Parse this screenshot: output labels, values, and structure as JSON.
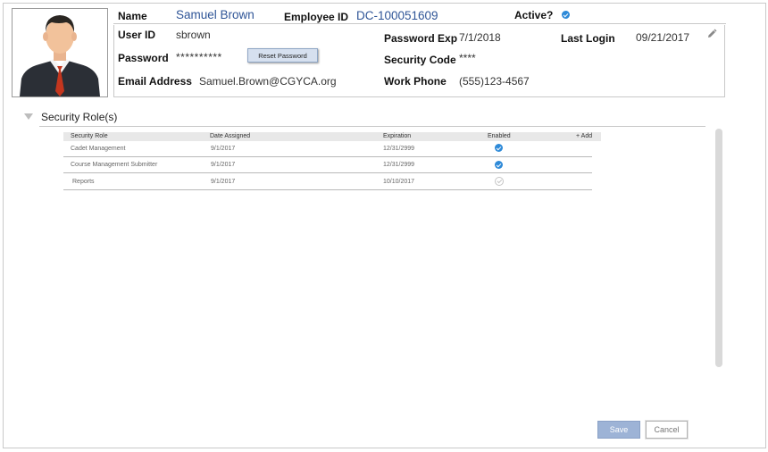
{
  "profile": {
    "name_label": "Name",
    "name_value": "Samuel Brown",
    "employee_id_label": "Employee ID",
    "employee_id_value": "DC-100051609",
    "active_label": "Active?",
    "active": true,
    "user_id_label": "User ID",
    "user_id_value": "sbrown",
    "password_label": "Password",
    "password_value": "**********",
    "reset_password_label": "Reset Password",
    "email_label": "Email Address",
    "email_value": "Samuel.Brown@CGYCA.org",
    "password_exp_label": "Password Exp",
    "password_exp_value": "7/1/2018",
    "security_code_label": "Security Code",
    "security_code_value": "****",
    "work_phone_label": "Work Phone",
    "work_phone_value": "(555)123-4567",
    "last_login_label": "Last Login",
    "last_login_value": "09/21/2017"
  },
  "security_roles": {
    "title": "Security Role(s)",
    "columns": [
      "Security Role",
      "Date Assigned",
      "Expiration",
      "Enabled"
    ],
    "add_label": "+ Add",
    "rows": [
      {
        "role": "Cadet Management",
        "date_assigned": "9/1/2017",
        "expiration": "12/31/2999",
        "enabled": true
      },
      {
        "role": "Course Management Submitter",
        "date_assigned": "9/1/2017",
        "expiration": "12/31/2999",
        "enabled": true
      },
      {
        "role": "Reports",
        "date_assigned": "9/1/2017",
        "expiration": "10/10/2017",
        "enabled": false
      }
    ]
  },
  "footer": {
    "save_label": "Save",
    "cancel_label": "Cancel"
  },
  "icons": {
    "edit": "pencil-icon",
    "collapse": "triangle-down-icon",
    "check": "check-circle-icon"
  },
  "colors": {
    "accent_blue": "#2e8ad8",
    "value_blue": "#2f5597",
    "save_button": "#9db3d6"
  }
}
